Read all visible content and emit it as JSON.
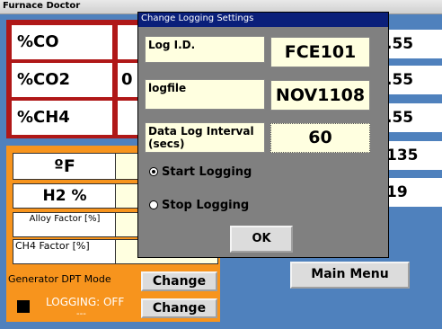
{
  "window": {
    "title": "Furnace Doctor"
  },
  "gas_readings": [
    {
      "label": "%CO",
      "value": ""
    },
    {
      "label": "%CO2",
      "value": "0"
    },
    {
      "label": "%CH4",
      "value": ""
    }
  ],
  "right_values": [
    ".55",
    ".55",
    ".55",
    "135",
    "19"
  ],
  "orange_panel": {
    "rows": [
      {
        "label": "ºF"
      },
      {
        "label": "H2 %"
      },
      {
        "label": "Alloy Factor [%]"
      },
      {
        "label": "CH4 Factor [%]"
      }
    ],
    "generator_mode_label": "Generator DPT Mode",
    "change_label_1": "Change",
    "change_label_2": "Change",
    "logging_status": "LOGGING: OFF",
    "logging_sub": "---"
  },
  "main_menu_label": "Main Menu",
  "dialog": {
    "title": "Change Logging Settings",
    "log_id_label": "Log I.D.",
    "log_id_value": "FCE101",
    "logfile_label": "logfile",
    "logfile_value": "NOV1108",
    "interval_label": "Data Log Interval (secs)",
    "interval_value": "60",
    "start_logging_label": "Start Logging",
    "start_logging_selected": true,
    "stop_logging_label": "Stop Logging",
    "ok_label": "OK"
  }
}
